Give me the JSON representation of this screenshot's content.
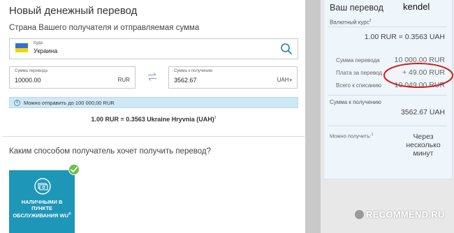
{
  "form": {
    "title": "Новый денежный перевод",
    "country_section_label": "Страна Вашего получателя и отправляемая сумма",
    "country": {
      "small_label": "Куда",
      "value": "Украина"
    },
    "send_amount": {
      "small_label": "Сумма перевода",
      "value": "10000.00",
      "currency": "RUR"
    },
    "receive_amount": {
      "small_label": "Сумма к получению",
      "value": "3562.67",
      "currency": "UAH",
      "arrow": "▾"
    },
    "info_text": "Можно отправить до 100 000,00 RUR",
    "rate_line": "1.00 RUR = 0.3563 Ukraine Hryvnia (UAH)",
    "rate_line_sup": "2",
    "question": "Каким способом получатель хочет получить перевод?",
    "method": {
      "label": "Наличными в пункте обслуживания WU",
      "label_sup": "®",
      "selected": true
    }
  },
  "summary": {
    "title": "Ваш перевод",
    "username": "kendel",
    "rate_label": "Валютный курс",
    "rate_label_sup": "2",
    "rate_value": "1.00 RUR = 0.3563 UAH",
    "rows": [
      {
        "label": "Сумма перевода",
        "value": "10 000.00 RUR"
      },
      {
        "label": "Плата за перевод",
        "value": "+ 49.00 RUR"
      },
      {
        "label": "Всего к списанию",
        "value": "10 049.00 RUR"
      }
    ],
    "receive_label": "Сумма к получению",
    "receive_value": "3562.67 UAH",
    "can_get_label": "Можно получить:",
    "can_get_label_sup": "1",
    "can_get_value_lines": [
      "Через",
      "несколько",
      "минут"
    ]
  },
  "watermark": {
    "text": "RECOMMEND.RU"
  },
  "colors": {
    "accent": "#1e96b8",
    "check": "#6ec14a",
    "annotation": "#d0201a",
    "flag_blue": "#2f6fd6",
    "flag_yellow": "#f5d400"
  },
  "icons": [
    "search-icon",
    "swap-icon",
    "info-icon",
    "cash-icon",
    "check-icon"
  ]
}
